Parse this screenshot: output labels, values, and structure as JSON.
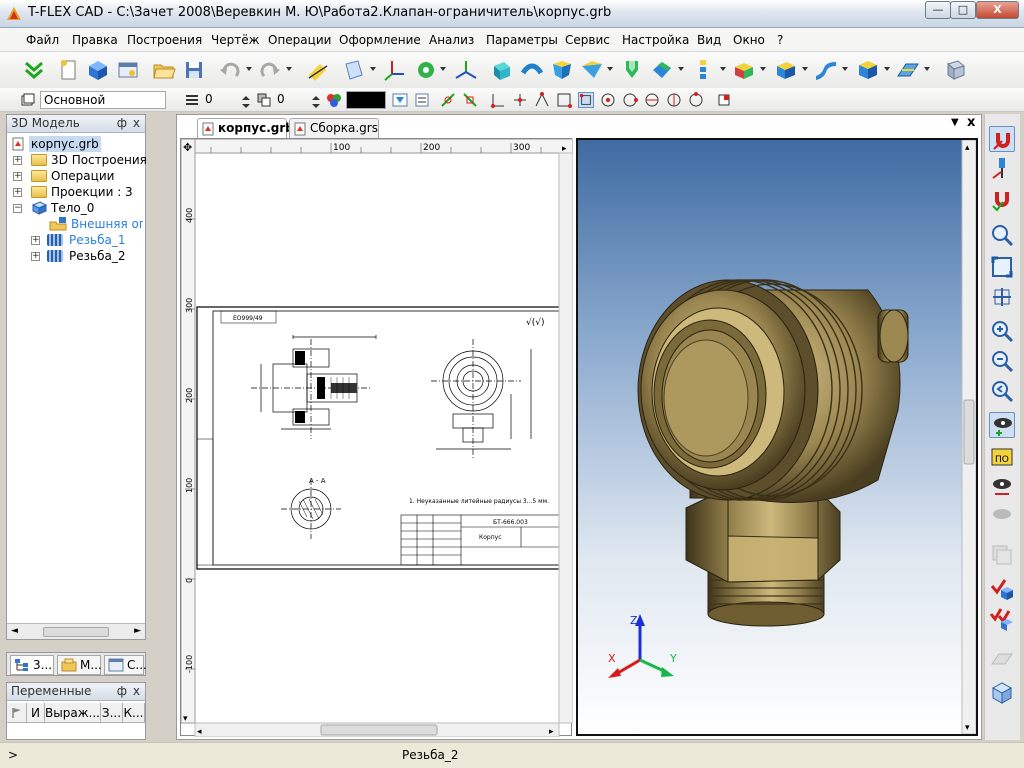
{
  "window": {
    "title": "T-FLEX CAD - C:\\Зачет 2008\\Веревкин М. Ю\\Работа2.Клапан-ограничитель\\корпус.grb",
    "min_label": "—",
    "max_label": "□",
    "close_label": "X"
  },
  "menu": [
    "Файл",
    "Правка",
    "Построения",
    "Чертёж",
    "Операции",
    "Оформление",
    "Анализ",
    "Параметры",
    "Сервис",
    "Настройка",
    "Вид",
    "Окно",
    "?"
  ],
  "toolbar2": {
    "layer_value": "Основной",
    "level_value": "0",
    "priority_value": "0",
    "color_hex": "#000000"
  },
  "left_panel": {
    "title": "3D Модель",
    "pin_label": "ф",
    "close_label": "x",
    "tree": [
      {
        "label": "корпус.grb"
      },
      {
        "label": "3D Построения"
      },
      {
        "label": "Операции"
      },
      {
        "label": "Проекции : 3"
      },
      {
        "label": "Тело_0"
      },
      {
        "label": "Внешняя опера"
      },
      {
        "label": "Резьба_1"
      },
      {
        "label": "Резьба_2"
      }
    ],
    "tabs": [
      "3...",
      "М...",
      "С..."
    ]
  },
  "variables_panel": {
    "title": "Переменные",
    "pin_label": "ф",
    "close_label": "x",
    "columns": [
      "И",
      "Выраж...",
      "З...",
      "К..."
    ]
  },
  "documents": {
    "tabs": [
      "корпус.grb",
      "Сборка.grs"
    ],
    "close_label": "x",
    "dropdown_label": "▼"
  },
  "drawing": {
    "ruler_top": [
      "100",
      "200",
      "300"
    ],
    "ruler_left": [
      "400",
      "300",
      "200",
      "100",
      "0",
      "-100"
    ],
    "sheet_code_label": "ЕО999/49",
    "note_text": "1. Неуказанные литейные радиусы 3...5 мм.",
    "doc_number": "БТ-666.003",
    "part_name": "Корпус",
    "section_label": "А - А"
  },
  "viewport3d": {
    "axis_x": "X",
    "axis_y": "Y",
    "axis_z": "Z"
  },
  "status": {
    "prompt": ">",
    "text": "Резьба_2"
  },
  "colors": {
    "brass": "#b8a46a",
    "brass_dark": "#5c4e2a",
    "bg_top": "#3f6ba2",
    "bg_bottom": "#ffffff"
  }
}
